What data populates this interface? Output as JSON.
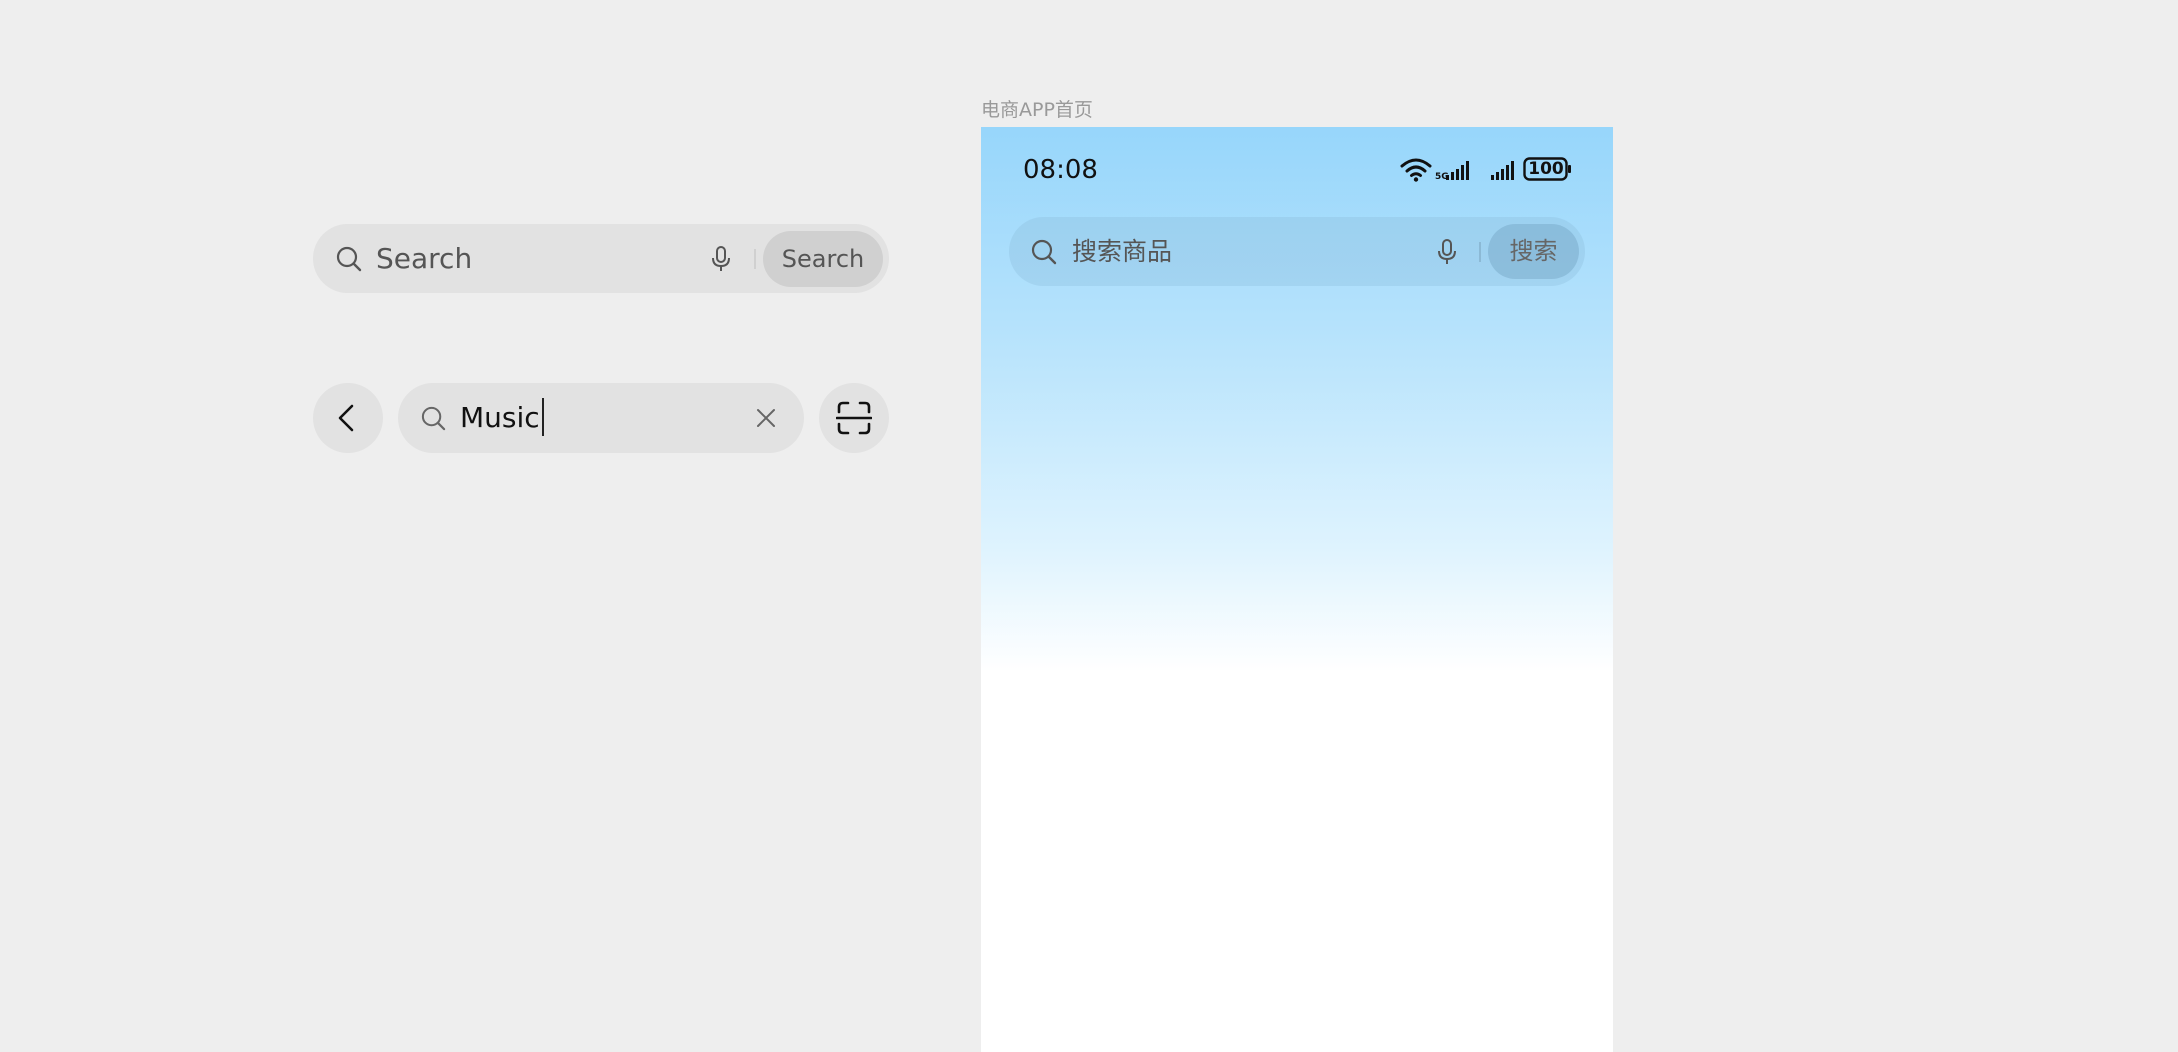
{
  "demo": {
    "search_bar": {
      "placeholder": "Search",
      "button_label": "Search"
    },
    "active_search": {
      "value": "Music"
    }
  },
  "phone_frame": {
    "label": "电商APP首页",
    "status_bar": {
      "time": "08:08",
      "battery": "100"
    },
    "search": {
      "placeholder": "搜索商品",
      "button_label": "搜索"
    }
  },
  "icons": [
    "search-icon",
    "mic-icon",
    "back-chevron-icon",
    "clear-icon",
    "scan-icon",
    "wifi-icon",
    "signal-5g-icon",
    "signal-icon",
    "battery-icon"
  ],
  "colors": {
    "canvas_bg": "#eeeeee",
    "control_bg": "#e2e2e2",
    "button_bg": "#d0d0d0",
    "gradient_top": "#97d6fb",
    "gradient_bottom": "#ffffff"
  }
}
